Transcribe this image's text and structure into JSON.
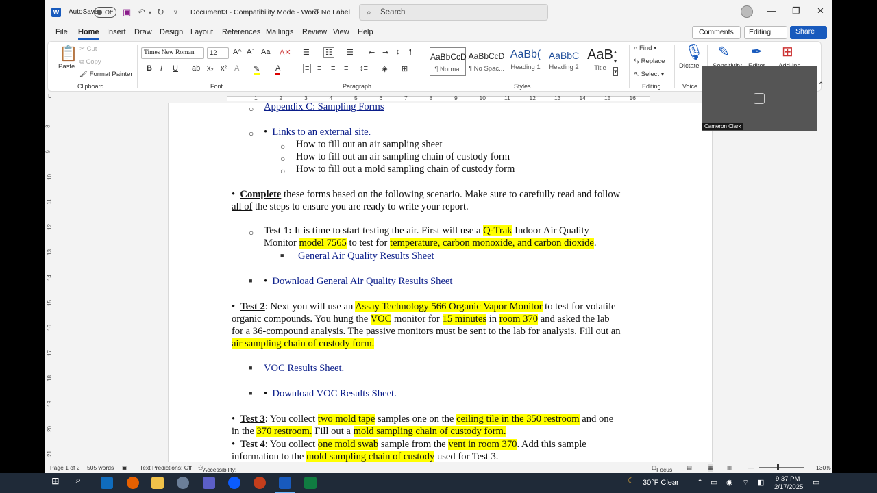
{
  "titlebar": {
    "app_letter": "W",
    "autosave": "AutoSave",
    "toggle": "Off",
    "doc_title": "Document3  -  Compatibility Mode  -  Word",
    "label": "No Label",
    "search_placeholder": "Search"
  },
  "tabs": [
    "File",
    "Home",
    "Insert",
    "Draw",
    "Design",
    "Layout",
    "References",
    "Mailings",
    "Review",
    "View",
    "Help"
  ],
  "right_buttons": {
    "comments": "Comments",
    "editing": "Editing",
    "share": "Share"
  },
  "ribbon": {
    "clipboard": {
      "paste": "Paste",
      "cut": "Cut",
      "copy": "Copy",
      "format_painter": "Format Painter",
      "label": "Clipboard"
    },
    "font": {
      "name": "Times New Roman",
      "size": "12",
      "label": "Font"
    },
    "paragraph": {
      "label": "Paragraph"
    },
    "styles": {
      "items": [
        {
          "preview": "AaBbCcD",
          "name": "¶ Normal"
        },
        {
          "preview": "AaBbCcD",
          "name": "¶ No Spac..."
        },
        {
          "preview": "AaBb(",
          "name": "Heading 1"
        },
        {
          "preview": "AaBbC",
          "name": "Heading 2"
        },
        {
          "preview": "AaB",
          "name": "Title"
        }
      ],
      "label": "Styles"
    },
    "editing": {
      "find": "Find",
      "replace": "Replace",
      "select": "Select",
      "label": "Editing"
    },
    "voice": {
      "dictate": "Dictate",
      "label": "Voice"
    },
    "sensitivity": "Sensitivity",
    "editor": "Editor",
    "addins": "Add-ins"
  },
  "ruler_numbers": [
    "1",
    "2",
    "3",
    "4",
    "5",
    "6",
    "7",
    "8",
    "9",
    "10",
    "11",
    "12",
    "13",
    "14",
    "15",
    "16"
  ],
  "vruler_numbers": [
    "8",
    "9",
    "10",
    "11",
    "12",
    "13",
    "14",
    "15",
    "16",
    "17",
    "18",
    "19",
    "20",
    "21"
  ],
  "video": {
    "name": "Cameron Clark"
  },
  "document": {
    "l1": "Appendix C: Sampling Forms",
    "l2": "Links to an external site.",
    "l3": "How to fill out an air sampling sheet",
    "l4": "How to fill out an air sampling chain of custody form",
    "l5": "How to fill out a mold sampling chain of custody form",
    "p1a": "Complete",
    "p1b": " these forms based on the following scenario. Make sure to carefully read and follow",
    "p1c": "all of",
    "p1d": " the steps to ensure you are ready to write your report.",
    "t1a": "Test 1:",
    "t1b": " It is time to start testing the air. First will use a ",
    "t1c": "Q-Trak",
    "t1d": " Indoor Air Quality",
    "t1e": "Monitor ",
    "t1f": "model 7565",
    "t1g": " to test for ",
    "t1h": "temperature, carbon monoxide, and carbon dioxide",
    "t1i": ".",
    "gaq": "General Air Quality Results Sheet",
    "dgaq": "Download General Air Quality Results Sheet",
    "t2a": "Test 2",
    "t2b": ": Next you will use an ",
    "t2c": "Assay Technology 566 Organic Vapor Monitor",
    "t2d": " to test for volatile",
    "t2e": "organic compounds. You hung the ",
    "t2f": "VOC",
    "t2g": " monitor for ",
    "t2h": "15 minutes",
    "t2i": " in ",
    "t2j": "room 370",
    "t2k": " and asked the lab",
    "t2l": "for a 36-compound analysis. The passive monitors must be sent to the lab for analysis. Fill out an",
    "t2m": "air sampling chain of custody form.",
    "voc": "VOC Results Sheet.",
    "dvoc": "Download VOC Results Sheet.",
    "t3a": "Test 3",
    "t3b": ": You collect ",
    "t3c": "two mold tape",
    "t3d": " samples one on the ",
    "t3e": "ceiling tile in the 350 restroom",
    "t3f": " and one",
    "t3g": "in the ",
    "t3h": "370 restroom.",
    "t3i": " Fill out a ",
    "t3j": "mold sampling chain of custody form.",
    "t4a": "Test 4",
    "t4b": ": You collect ",
    "t4c": "one mold swab",
    "t4d": " sample from the ",
    "t4e": "vent in room 370",
    "t4f": ". Add this sample",
    "t4g": "information to the ",
    "t4h": "mold sampling chain of custody",
    "t4i": " used for Test 3."
  },
  "status": {
    "page": "Page 1 of 2",
    "words": "505 words",
    "predictions": "Text Predictions: Off",
    "accessibility": "Accessibility: Unavailable",
    "focus": "Focus",
    "zoom": "130%"
  },
  "taskbar": {
    "weather": "30°F  Clear",
    "time": "9:37 PM",
    "date": "2/17/2025"
  },
  "colors": {
    "accent": "#185abd",
    "highlight": "#ffff00",
    "link": "#0a1d8a"
  }
}
